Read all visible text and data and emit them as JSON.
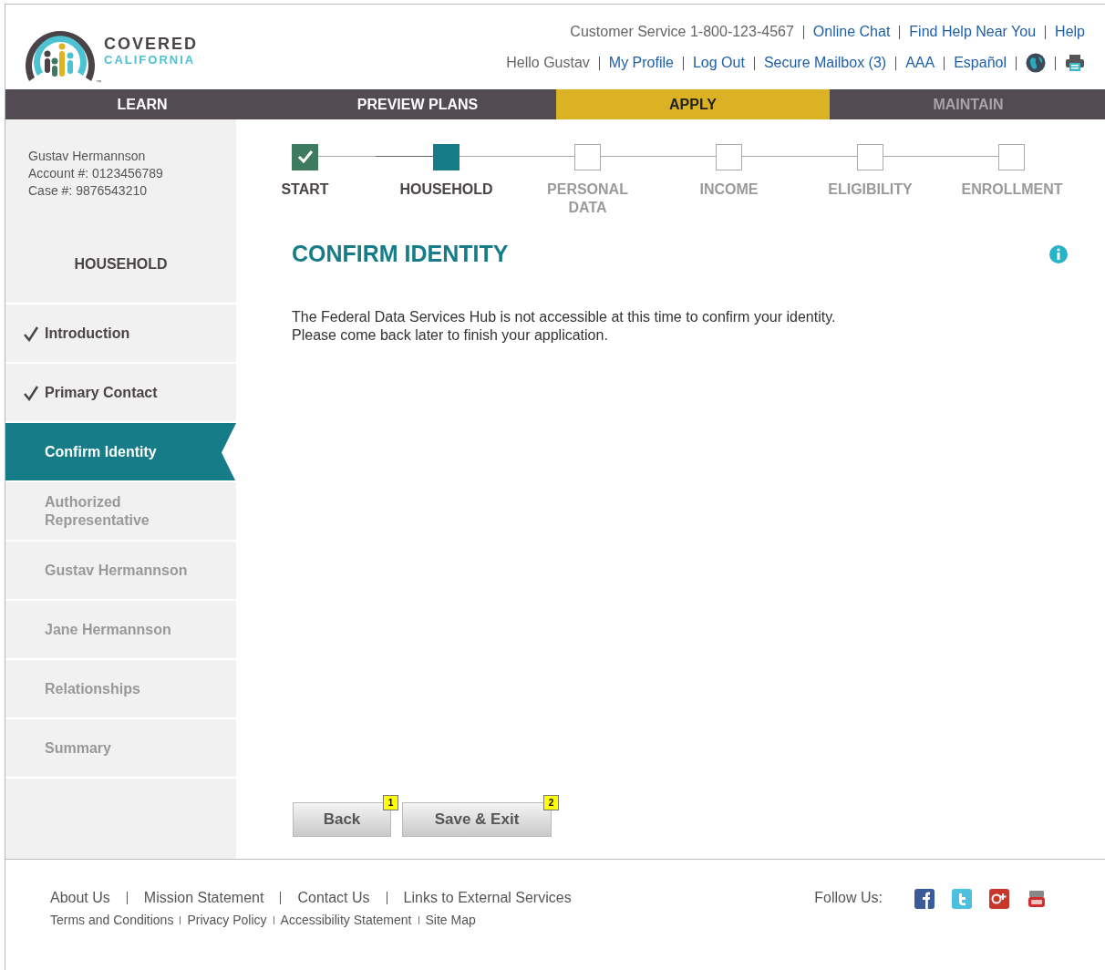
{
  "logo": {
    "line1": "COVERED",
    "line2": "CALIFORNIA",
    "mark": "™"
  },
  "utility_top": [
    {
      "text": "Customer Service 1-800-123-4567",
      "kind": "plain"
    },
    {
      "text": "Online Chat",
      "kind": "link"
    },
    {
      "text": "Find Help Near You",
      "kind": "link"
    },
    {
      "text": "Help",
      "kind": "link"
    }
  ],
  "utility_bottom": [
    {
      "text": "Hello Gustav",
      "kind": "plain"
    },
    {
      "text": "My Profile",
      "kind": "link"
    },
    {
      "text": "Log Out",
      "kind": "link"
    },
    {
      "text": "Secure Mailbox (3)",
      "kind": "link"
    },
    {
      "text": "AAA",
      "kind": "textsize"
    },
    {
      "text": "Español",
      "kind": "link"
    },
    {
      "kind": "globe"
    },
    {
      "kind": "print"
    }
  ],
  "nav": [
    {
      "label": "LEARN",
      "selected": false,
      "disabled": false
    },
    {
      "label": "PREVIEW PLANS",
      "selected": false,
      "disabled": false
    },
    {
      "label": "APPLY",
      "selected": true,
      "disabled": false
    },
    {
      "label": "MAINTAIN",
      "selected": false,
      "disabled": true
    }
  ],
  "account": [
    "Gustav Hermannson",
    "Account #: 0123456789",
    "Case #: 9876543210"
  ],
  "sidebar": {
    "title": "HOUSEHOLD",
    "items": [
      {
        "label": "Introduction",
        "checked": true,
        "selected": false
      },
      {
        "label": "Primary Contact",
        "checked": true,
        "selected": false
      },
      {
        "label": "Confirm Identity",
        "checked": false,
        "selected": true
      },
      {
        "label": "Authorized Representative",
        "checked": false,
        "selected": false
      },
      {
        "label": "Gustav Hermannson",
        "checked": false,
        "selected": false
      },
      {
        "label": "Jane Hermannson",
        "checked": false,
        "selected": false
      },
      {
        "label": "Relationships",
        "checked": false,
        "selected": false
      },
      {
        "label": "Summary",
        "checked": false,
        "selected": false
      }
    ]
  },
  "steps": [
    {
      "label": "START",
      "completed": true,
      "current": false
    },
    {
      "label": "HOUSEHOLD",
      "completed": false,
      "current": true
    },
    {
      "label": "PERSONAL DATA",
      "completed": false,
      "current": false
    },
    {
      "label": "INCOME",
      "completed": false,
      "current": false
    },
    {
      "label": "ELIGIBILITY",
      "completed": false,
      "current": false
    },
    {
      "label": "ENROLLMENT",
      "completed": false,
      "current": false
    }
  ],
  "heading": "CONFIRM IDENTITY",
  "message": [
    "The Federal Data Services Hub is not accessible at this time to confirm your identity.",
    "Please come back later to finish your application."
  ],
  "buttons": [
    {
      "label": "Back",
      "badge": "1"
    },
    {
      "label": "Save & Exit",
      "badge": "2"
    }
  ],
  "footer": {
    "links_top": [
      "About Us",
      "Mission Statement",
      "Contact Us",
      "Links to External Services"
    ],
    "links_bottom": [
      "Terms and Conditions",
      "Privacy Policy",
      "Accessibility Statement",
      "Site Map"
    ],
    "follow": "Follow Us:",
    "social": [
      {
        "kind": "facebook"
      },
      {
        "kind": "twitter"
      },
      {
        "kind": "googleplus"
      },
      {
        "kind": "video"
      }
    ]
  }
}
